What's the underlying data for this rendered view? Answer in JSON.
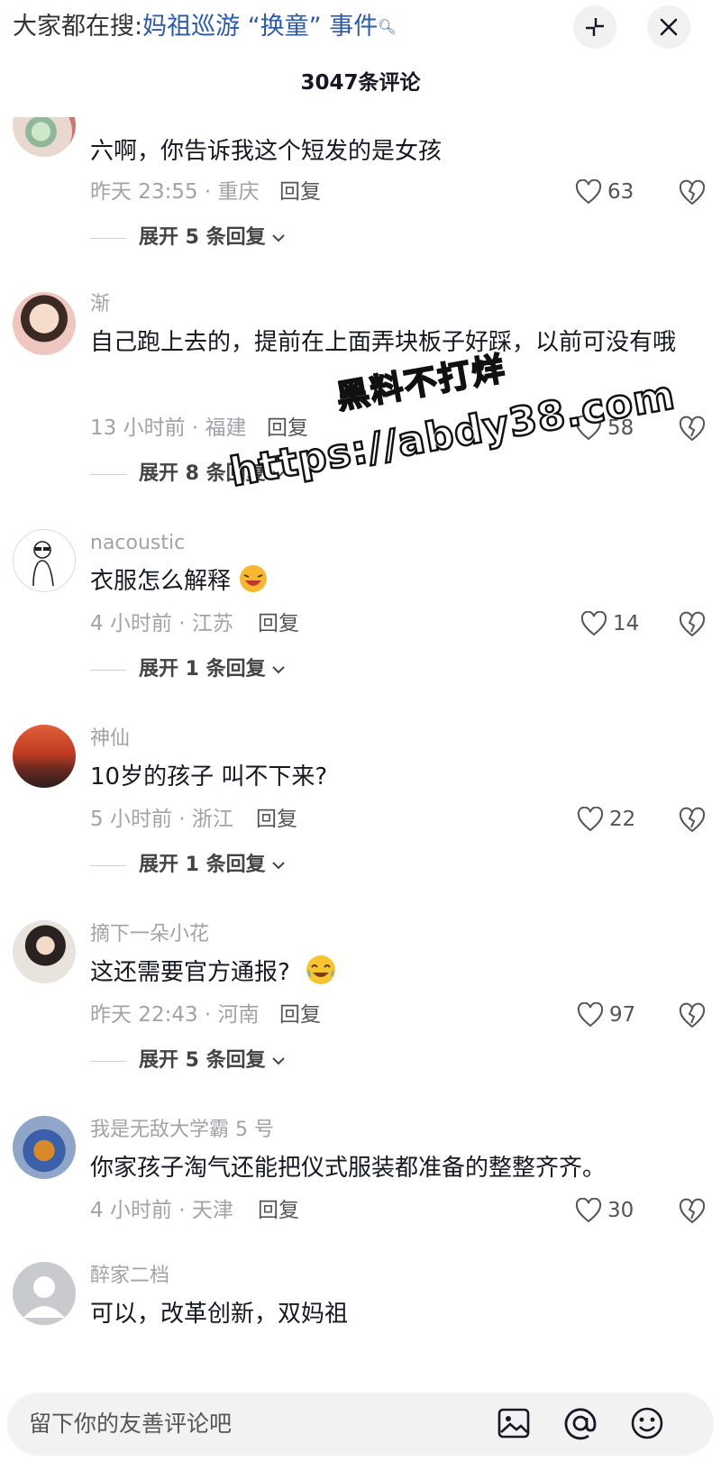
{
  "header": {
    "hot_label": "大家都在搜:",
    "hot_keyword": "妈祖巡游 “换童” 事件",
    "comment_count": "3047条评论"
  },
  "comments": [
    {
      "username": "",
      "text": "六啊，你告诉我这个短发的是女孩",
      "time": "昨天 23:55 · 重庆",
      "reply": "回复",
      "likes": "63",
      "expand": "展开 5 条回复"
    },
    {
      "username": "渐",
      "text": "自己跑上去的，提前在上面弄块板子好踩，以前可没有哦",
      "time": "13 小时前 · 福建",
      "reply": "回复",
      "likes": "58",
      "expand": "展开 8 条回复"
    },
    {
      "username": "nacoustic",
      "text": "衣服怎么解释",
      "time": "4 小时前 · 江苏",
      "reply": "回复",
      "likes": "14",
      "expand": "展开 1 条回复"
    },
    {
      "username": "神仙",
      "text": "10岁的孩子  叫不下来?",
      "time": "5 小时前 · 浙江",
      "reply": "回复",
      "likes": "22",
      "expand": "展开 1 条回复"
    },
    {
      "username": "摘下一朵小花",
      "text": "这还需要官方通报?",
      "time": "昨天 22:43 · 河南",
      "reply": "回复",
      "likes": "97",
      "expand": "展开 5 条回复"
    },
    {
      "username": "我是无敌大学霸 5 号",
      "text": "你家孩子淘气还能把仪式服装都准备的整整齐齐。",
      "time": "4 小时前 · 天津",
      "reply": "回复",
      "likes": "30",
      "expand": ""
    },
    {
      "username": "醉家二档",
      "text": "可以，改革创新，双妈祖",
      "time": "",
      "reply": "",
      "likes": "",
      "expand": ""
    }
  ],
  "watermark": {
    "line1": "黑料不打烊",
    "line2": "https://abdy38.com"
  },
  "input": {
    "placeholder": "留下你的友善评论吧"
  },
  "icons": [
    "search-icon",
    "collapse-icon",
    "close-icon",
    "heart-icon",
    "dislike-icon",
    "chevron-down-icon",
    "image-icon",
    "at-icon",
    "emoji-icon"
  ],
  "colors": {
    "keyword": "#2d5ba8",
    "meta": "#a2a3a8",
    "text": "#161823"
  }
}
